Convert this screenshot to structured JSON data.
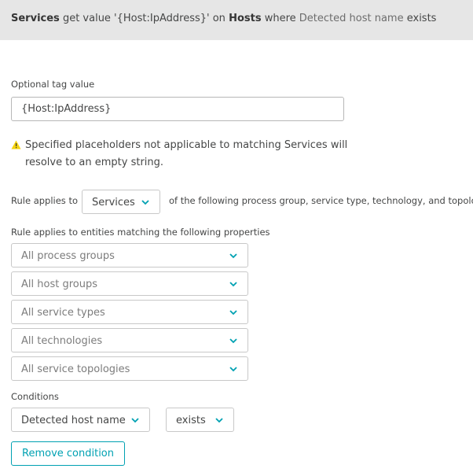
{
  "header": {
    "entity": "Services",
    "get_value": "get value '{Host:IpAddress}' on",
    "target": "Hosts",
    "where": "where",
    "condition": "Detected host name",
    "operator": "exists"
  },
  "tag_value": {
    "label": "Optional tag value",
    "value": "{Host:IpAddress}"
  },
  "warning": {
    "icon": "warning-icon",
    "text": "Specified placeholders not applicable to matching Services will resolve to an empty string."
  },
  "rule_applies": {
    "label": "Rule applies to",
    "selected": "Services",
    "suffix": "of the following process group, service type, technology, and topology"
  },
  "properties": {
    "label": "Rule applies to entities matching the following properties",
    "dropdowns": [
      {
        "value": "All process groups"
      },
      {
        "value": "All host groups"
      },
      {
        "value": "All service types"
      },
      {
        "value": "All technologies"
      },
      {
        "value": "All service topologies"
      }
    ]
  },
  "conditions": {
    "label": "Conditions",
    "attribute": "Detected host name",
    "operator": "exists",
    "remove_label": "Remove condition"
  },
  "colors": {
    "accent": "#00a1b2",
    "warning": "#f5d30f",
    "header_bg": "#e6e6e6"
  }
}
